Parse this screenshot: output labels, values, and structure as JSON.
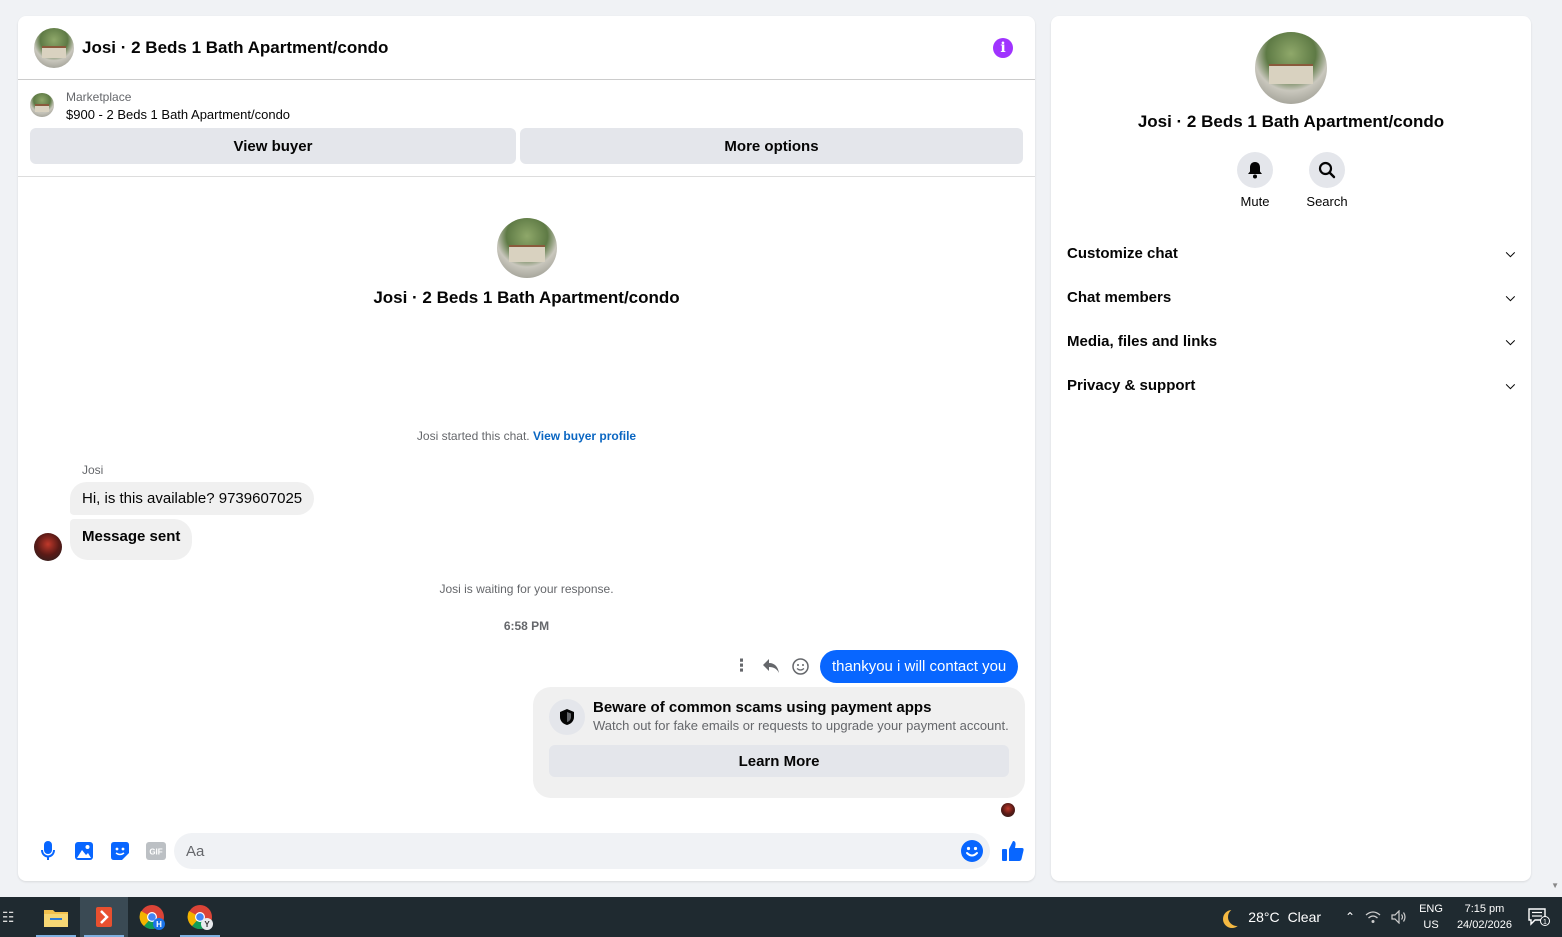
{
  "chat": {
    "title": "Josi · 2 Beds 1 Bath Apartment/condo",
    "marketplace_label": "Marketplace",
    "listing": "$900 - 2 Beds 1 Bath Apartment/condo",
    "view_buyer_label": "View buyer",
    "more_options_label": "More options",
    "intro_name": "Josi · 2 Beds 1 Bath Apartment/condo",
    "started_text": "Josi started this chat.",
    "view_buyer_profile_label": "View buyer profile",
    "sender_name": "Josi",
    "messages_in": [
      "Hi, is this available? 9739607025",
      "Message sent"
    ],
    "waiting_text": "Josi is waiting for your response.",
    "timestamp": "6:58 PM",
    "message_out": "thankyou i will contact you",
    "scam_title": "Beware of common scams using payment apps",
    "scam_sub": "Watch out for fake emails or requests to upgrade your payment account.",
    "learn_more_label": "Learn More",
    "composer_placeholder": "Aa",
    "composer_gif": "GIF"
  },
  "side": {
    "name": "Josi · 2 Beds 1 Bath Apartment/condo",
    "mute_label": "Mute",
    "search_label": "Search",
    "items": [
      {
        "label": "Customize chat"
      },
      {
        "label": "Chat members"
      },
      {
        "label": "Media, files and links"
      },
      {
        "label": "Privacy & support"
      }
    ]
  },
  "taskbar": {
    "weather": "28°C",
    "weather_desc": "Clear",
    "lang_top": "ENG",
    "lang_bottom": "US",
    "time": "7:15 pm",
    "date": "24/02/2026",
    "notif_count": "1",
    "chrome_badge_1": "H",
    "chrome_badge_2": "Y"
  },
  "colors": {
    "accent": "#0866ff",
    "info": "#a033ff",
    "taskbar": "#1f2a30"
  }
}
